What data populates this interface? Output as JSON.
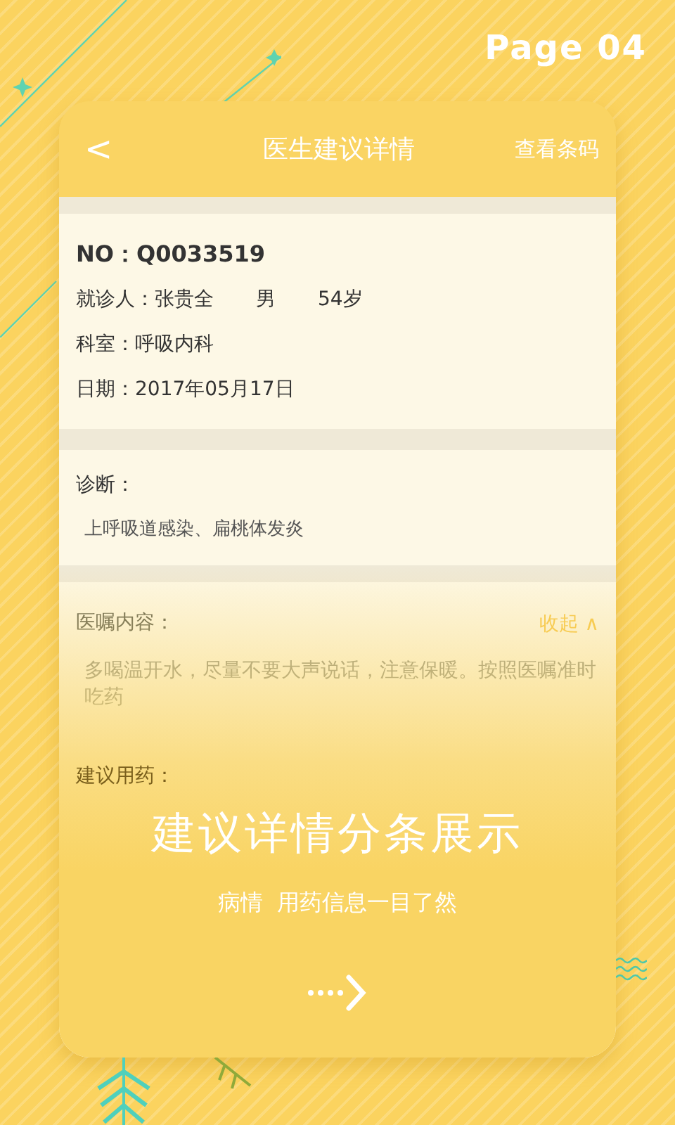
{
  "page_label": "Page 04",
  "header": {
    "back": "<",
    "title": "医生建议详情",
    "action": "查看条码"
  },
  "record": {
    "number": "NO：Q0033519",
    "patient": [
      {
        "text": "就诊人：张贵全"
      },
      {
        "text": "男"
      },
      {
        "text": "54岁"
      }
    ],
    "department": "科室：呼吸内科",
    "date": "日期：2017年05月17日"
  },
  "diagnosis": {
    "label": "诊断：",
    "text": "上呼吸道感染、扁桃体发炎"
  },
  "advice": {
    "label": "医嘱内容：",
    "toggle": "收起 ∧",
    "expanded": true,
    "text": "多喝温开水，尽量不要大声说话，注意保暖。按照医嘱准时吃药"
  },
  "medication": {
    "label": "建议用药："
  },
  "promo": {
    "headline": "建议详情分条展示",
    "subtitle": "病情  用药信息一目了然"
  }
}
